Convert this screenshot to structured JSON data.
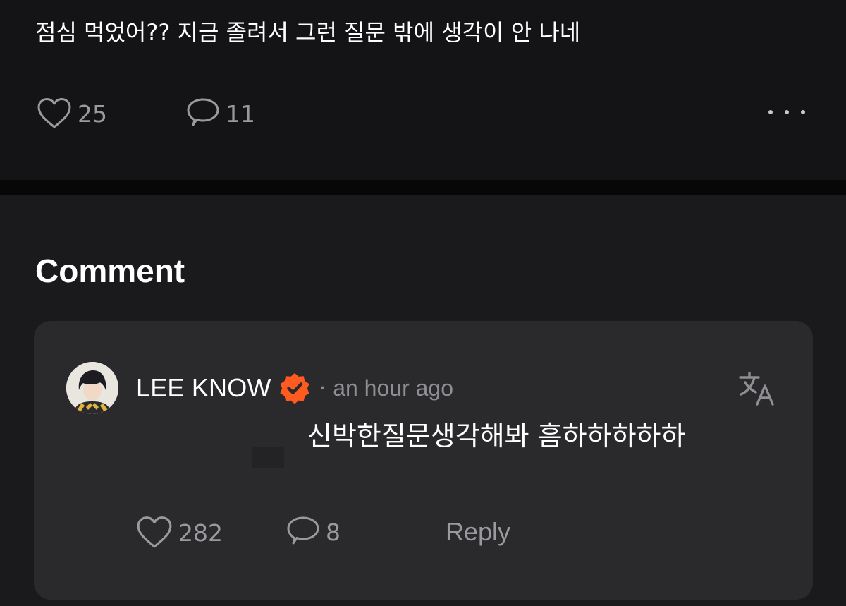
{
  "post": {
    "text": "점심 먹었어?? 지금 졸려서 그런 질문 밖에 생각이 안 나네",
    "like_count": "25",
    "comment_count": "11"
  },
  "comments_section": {
    "title": "Comment"
  },
  "comment": {
    "author": "LEE KNOW",
    "separator": "·",
    "timestamp": "an hour ago",
    "text": "신박한질문생각해봐 흠하하하하하",
    "like_count": "282",
    "reply_count": "8",
    "reply_label": "Reply"
  },
  "colors": {
    "background": "#141416",
    "card": "#2a2a2d",
    "muted_text": "#9a9a9e",
    "verified_badge": "#ff5a1f"
  },
  "icons": [
    "heart-icon",
    "comment-bubble-icon",
    "more-icon",
    "verified-badge-icon",
    "translate-icon"
  ]
}
